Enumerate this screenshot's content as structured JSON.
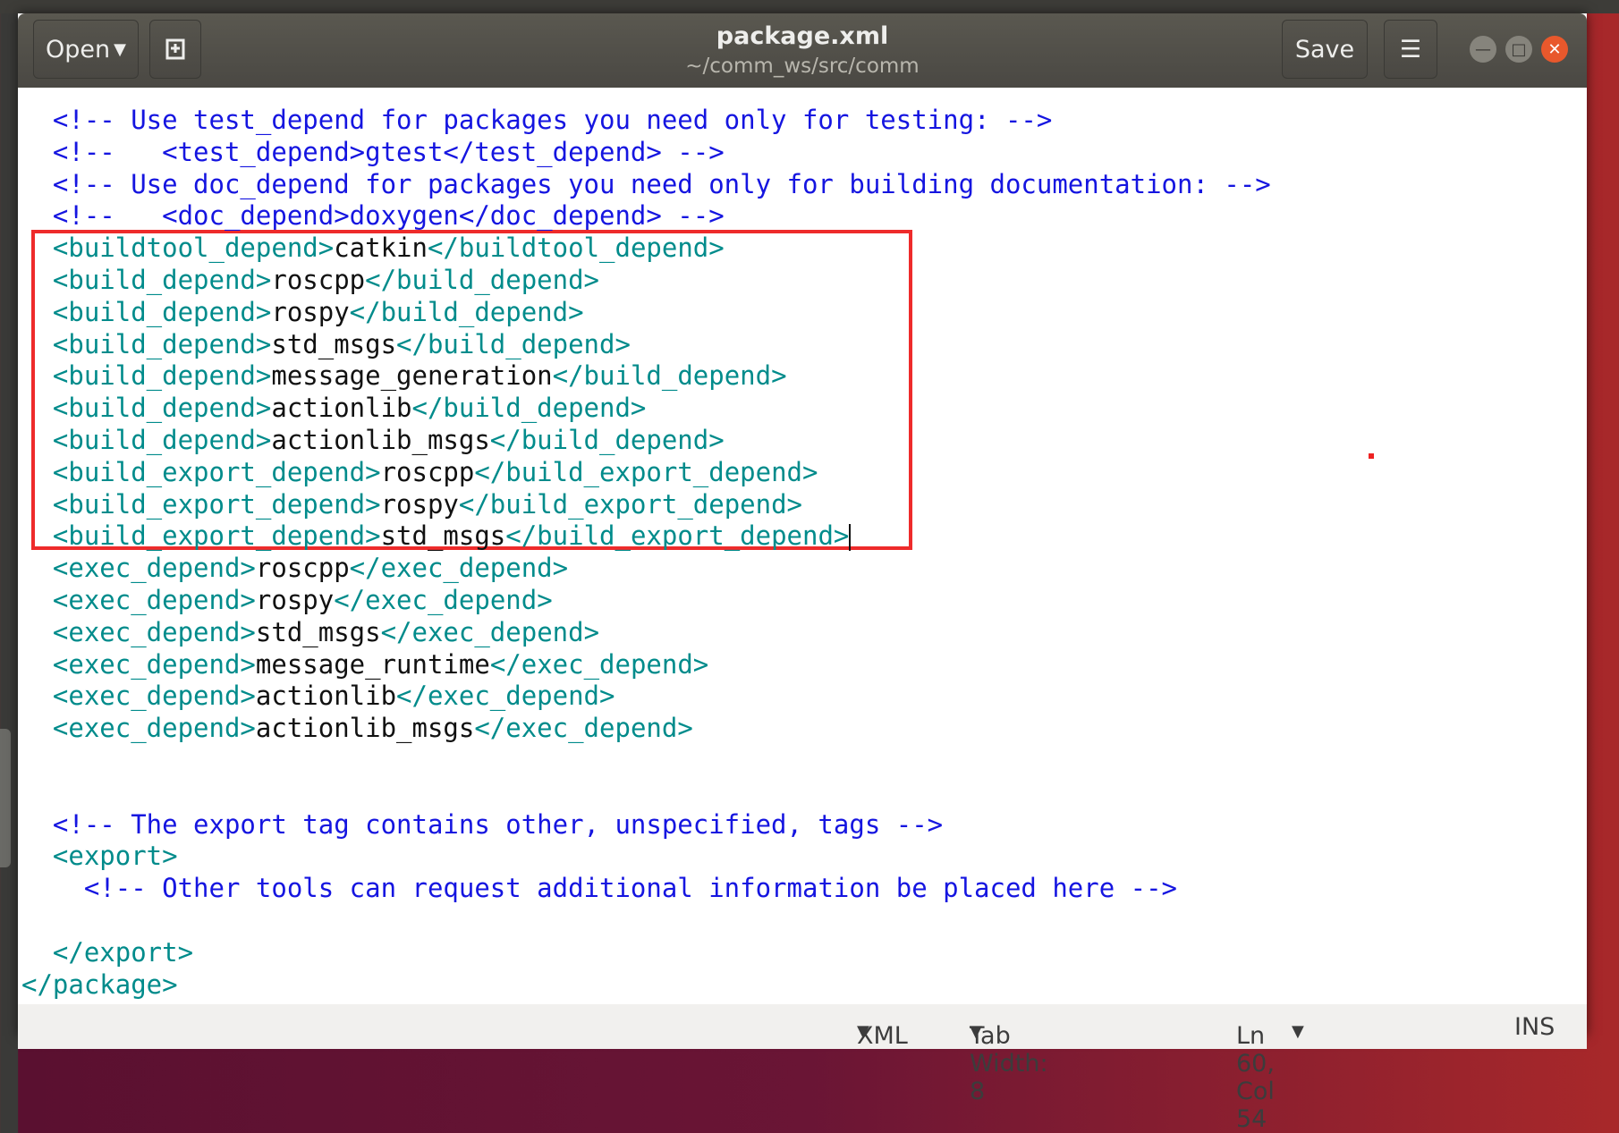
{
  "window": {
    "title": "package.xml",
    "subtitle": "~/comm_ws/src/comm"
  },
  "toolbar": {
    "open_label": "Open",
    "save_label": "Save"
  },
  "icons": {
    "new_document": "new-document-icon",
    "menu": "hamburger-menu-icon",
    "minimize": "minimize-icon",
    "maximize": "maximize-icon",
    "close": "close-icon"
  },
  "colors": {
    "comment": "#1515e0",
    "tag": "#008b8b",
    "text": "#111111",
    "highlight_box": "#ee2b2b",
    "close_button": "#e8582c"
  },
  "editor": {
    "lines": [
      {
        "indent": "  ",
        "parts": [
          {
            "k": "c",
            "s": "<!-- Use test_depend for packages you need only for testing: -->"
          }
        ]
      },
      {
        "indent": "  ",
        "parts": [
          {
            "k": "c",
            "s": "<!--   <test_depend>gtest</test_depend> -->"
          }
        ]
      },
      {
        "indent": "  ",
        "parts": [
          {
            "k": "c",
            "s": "<!-- Use doc_depend for packages you need only for building documentation: -->"
          }
        ]
      },
      {
        "indent": "  ",
        "parts": [
          {
            "k": "c",
            "s": "<!--   <doc_depend>doxygen</doc_depend> -->"
          }
        ]
      },
      {
        "indent": "  ",
        "parts": [
          {
            "k": "t",
            "s": "<buildtool_depend>"
          },
          {
            "k": "x",
            "s": "catkin"
          },
          {
            "k": "t",
            "s": "</buildtool_depend>"
          }
        ]
      },
      {
        "indent": "  ",
        "parts": [
          {
            "k": "t",
            "s": "<build_depend>"
          },
          {
            "k": "x",
            "s": "roscpp"
          },
          {
            "k": "t",
            "s": "</build_depend>"
          }
        ]
      },
      {
        "indent": "  ",
        "parts": [
          {
            "k": "t",
            "s": "<build_depend>"
          },
          {
            "k": "x",
            "s": "rospy"
          },
          {
            "k": "t",
            "s": "</build_depend>"
          }
        ]
      },
      {
        "indent": "  ",
        "parts": [
          {
            "k": "t",
            "s": "<build_depend>"
          },
          {
            "k": "x",
            "s": "std_msgs"
          },
          {
            "k": "t",
            "s": "</build_depend>"
          }
        ]
      },
      {
        "indent": "  ",
        "parts": [
          {
            "k": "t",
            "s": "<build_depend>"
          },
          {
            "k": "x",
            "s": "message_generation"
          },
          {
            "k": "t",
            "s": "</build_depend>"
          }
        ]
      },
      {
        "indent": "  ",
        "parts": [
          {
            "k": "t",
            "s": "<build_depend>"
          },
          {
            "k": "x",
            "s": "actionlib"
          },
          {
            "k": "t",
            "s": "</build_depend>"
          }
        ]
      },
      {
        "indent": "  ",
        "parts": [
          {
            "k": "t",
            "s": "<build_depend>"
          },
          {
            "k": "x",
            "s": "actionlib_msgs"
          },
          {
            "k": "t",
            "s": "</build_depend>"
          }
        ]
      },
      {
        "indent": "  ",
        "parts": [
          {
            "k": "t",
            "s": "<build_export_depend>"
          },
          {
            "k": "x",
            "s": "roscpp"
          },
          {
            "k": "t",
            "s": "</build_export_depend>"
          }
        ]
      },
      {
        "indent": "  ",
        "parts": [
          {
            "k": "t",
            "s": "<build_export_depend>"
          },
          {
            "k": "x",
            "s": "rospy"
          },
          {
            "k": "t",
            "s": "</build_export_depend>"
          }
        ]
      },
      {
        "indent": "  ",
        "parts": [
          {
            "k": "t",
            "s": "<build_export_depend>"
          },
          {
            "k": "x",
            "s": "std_msgs"
          },
          {
            "k": "t",
            "s": "</build_export_depend>"
          }
        ],
        "cursor": true
      },
      {
        "indent": "  ",
        "parts": [
          {
            "k": "t",
            "s": "<exec_depend>"
          },
          {
            "k": "x",
            "s": "roscpp"
          },
          {
            "k": "t",
            "s": "</exec_depend>"
          }
        ]
      },
      {
        "indent": "  ",
        "parts": [
          {
            "k": "t",
            "s": "<exec_depend>"
          },
          {
            "k": "x",
            "s": "rospy"
          },
          {
            "k": "t",
            "s": "</exec_depend>"
          }
        ]
      },
      {
        "indent": "  ",
        "parts": [
          {
            "k": "t",
            "s": "<exec_depend>"
          },
          {
            "k": "x",
            "s": "std_msgs"
          },
          {
            "k": "t",
            "s": "</exec_depend>"
          }
        ]
      },
      {
        "indent": "  ",
        "parts": [
          {
            "k": "t",
            "s": "<exec_depend>"
          },
          {
            "k": "x",
            "s": "message_runtime"
          },
          {
            "k": "t",
            "s": "</exec_depend>"
          }
        ]
      },
      {
        "indent": "  ",
        "parts": [
          {
            "k": "t",
            "s": "<exec_depend>"
          },
          {
            "k": "x",
            "s": "actionlib"
          },
          {
            "k": "t",
            "s": "</exec_depend>"
          }
        ]
      },
      {
        "indent": "  ",
        "parts": [
          {
            "k": "t",
            "s": "<exec_depend>"
          },
          {
            "k": "x",
            "s": "actionlib_msgs"
          },
          {
            "k": "t",
            "s": "</exec_depend>"
          }
        ]
      },
      {
        "indent": "",
        "parts": []
      },
      {
        "indent": "",
        "parts": []
      },
      {
        "indent": "  ",
        "parts": [
          {
            "k": "c",
            "s": "<!-- The export tag contains other, unspecified, tags -->"
          }
        ]
      },
      {
        "indent": "  ",
        "parts": [
          {
            "k": "t",
            "s": "<export>"
          }
        ]
      },
      {
        "indent": "    ",
        "parts": [
          {
            "k": "c",
            "s": "<!-- Other tools can request additional information be placed here -->"
          }
        ]
      },
      {
        "indent": "",
        "parts": []
      },
      {
        "indent": "  ",
        "parts": [
          {
            "k": "t",
            "s": "</export>"
          }
        ]
      },
      {
        "indent": "",
        "parts": [
          {
            "k": "t",
            "s": "</package>"
          }
        ]
      }
    ]
  },
  "statusbar": {
    "language": "XML",
    "tab_width": "Tab Width: 8",
    "position": "Ln 60, Col 54",
    "mode": "INS"
  }
}
